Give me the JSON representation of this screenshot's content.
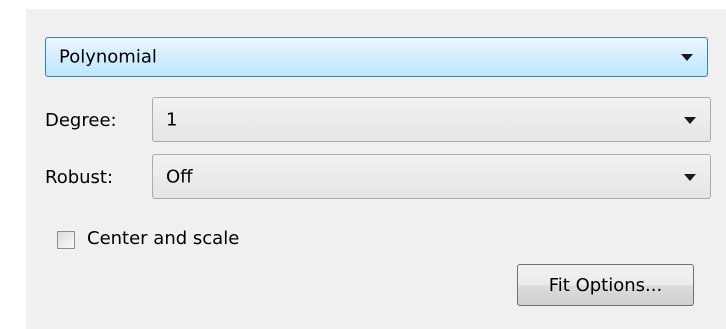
{
  "fit_panel": {
    "model_type": {
      "selected": "Polynomial"
    },
    "degree": {
      "label": "Degree:",
      "selected": "1"
    },
    "robust": {
      "label": "Robust:",
      "selected": "Off"
    },
    "center_and_scale": {
      "label": "Center and scale",
      "checked": false
    },
    "fit_options_button": {
      "label": "Fit Options..."
    }
  },
  "icons": {
    "dropdown_arrow": "chevron-down-icon"
  },
  "colors": {
    "panel_background": "#f0f0f0",
    "focused_dropdown_border": "#3c7fb1",
    "focused_dropdown_fill_top": "#eaf6fd",
    "focused_dropdown_fill_bottom": "#bee6fd"
  }
}
